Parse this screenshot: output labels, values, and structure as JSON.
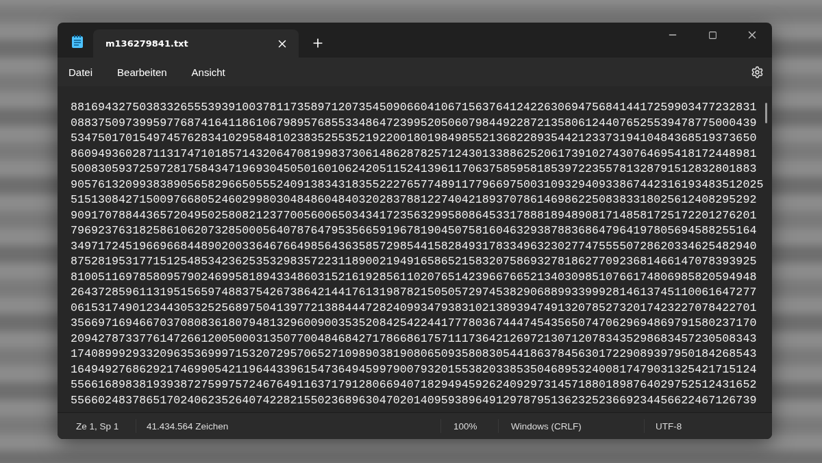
{
  "tabs": [
    {
      "label": "m136279841.txt",
      "selected": true
    }
  ],
  "menu": [
    "Datei",
    "Bearbeiten",
    "Ansicht"
  ],
  "lines": [
    "8816943275038332655539391003781173589712073545090660410671563764124226306947568414417259903477232831",
    "0883750973995977687416411861067989576855334864723995205060798449228721358061244076525539478775000439",
    "5347501701549745762834102958481023835255352192200180198498552136822893544212337319410484368519373650",
    "8609493602871131747101857143206470819983730614862878257124301338862520617391027430764695418172448981",
    "5008305937259728175843471969304505016010624205115241396117063758595818539722355781328791512832801883",
    "90576132099383890565829665055524091383431835522276577489117796697500310932940933867442316193483512025",
    "5151308427150097668052460299803048486048403202837881227404218937078614698622508383318025612408295292",
    "9091707884436572049502580821237700560065034341723563299580864533178881894890817148581725172201276201",
    "7969237631825861062073285000564078764795356659196781904507581604632938788368647964197805694588255164",
    "3497172451966966844890200336467664985643635857298544158284931783349632302774755550728620334625482940",
    "8752819531771512548534236253532983572231189002194916586521583207586932781862770923681466147078393925",
    "8100511697858095790246995818943348603152161928561102076514239667665213403098510766174806985820594948",
    "2643728596113195156597488375426738642144176131987821505057297453829068899339992814613745110061647277",
    "0615317490123443053252568975041397721388444728240993479383102138939474913207852732017423227078422701",
    "3566971694667037080836180794813296009003535208425422441777803674447454356507470629694869791580237170",
    "2094278733776147266120050003135077004846842717866861757111736421269721307120783435298683457230508343",
    "1740899929332096353699971532072957065271098903819080650935808305441863784563017229089397950184268543",
    "1649492768629217469905421196443396154736494599790079320155382033853504689532400817479031325421715124",
    "5566168983819393872759975724676491163717912806694071829494592624092973145718801898764029752512431652",
    "5566024837865170240623526407422821550236896304702014095938964912978795136232523669234456622467126739"
  ],
  "status": [
    "Ze 1, Sp 1",
    "41.434.564 Zeichen",
    "100%",
    "Windows (CRLF)",
    "UTF-8"
  ]
}
